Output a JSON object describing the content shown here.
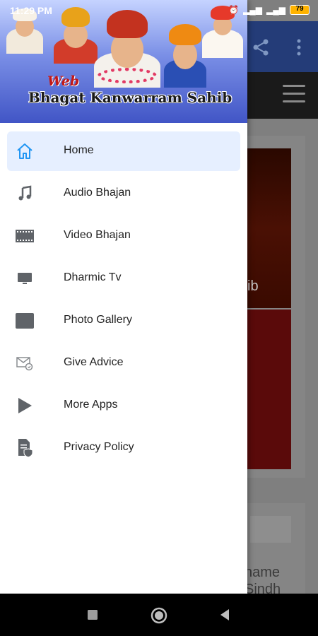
{
  "status_bar": {
    "time": "11:29 PM",
    "battery": "79"
  },
  "header": {
    "web": "Web",
    "title": "Bhagat Kanwarram Sahib"
  },
  "menu": [
    {
      "label": "Home",
      "icon": "home-icon",
      "selected": true
    },
    {
      "label": "Audio Bhajan",
      "icon": "music-note-icon"
    },
    {
      "label": "Video Bhajan",
      "icon": "film-icon"
    },
    {
      "label": "Dharmic Tv",
      "icon": "tv-icon"
    },
    {
      "label": "Photo Gallery",
      "icon": "photo-icon"
    },
    {
      "label": "Give Advice",
      "icon": "mail-advice-icon"
    },
    {
      "label": "More Apps",
      "icon": "play-icon"
    },
    {
      "label": "Privacy Policy",
      "icon": "privacy-document-icon"
    }
  ],
  "background": {
    "partial_text_1": "ib",
    "partial_text_2": "name\nSindh"
  },
  "colors": {
    "appbar": "#243c78",
    "accent": "#1e88e5",
    "selected_bg": "#e6efff"
  }
}
